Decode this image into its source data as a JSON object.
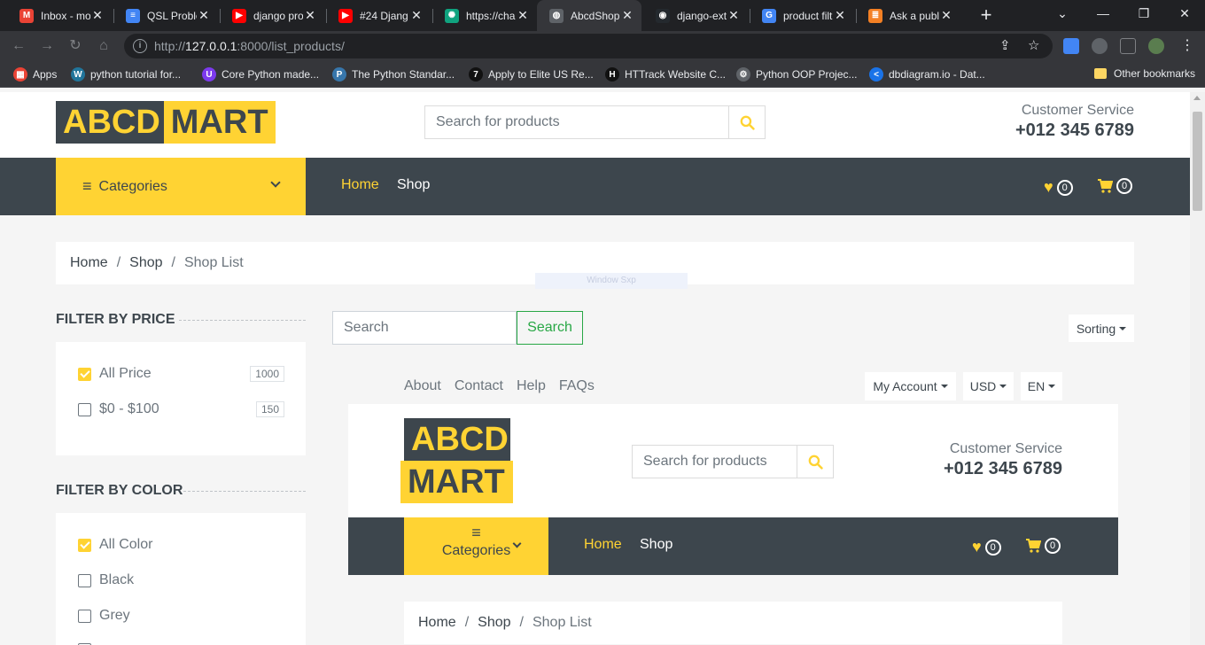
{
  "browser": {
    "tabs": [
      {
        "title": "Inbox - mo",
        "fav_color": "#ea4335",
        "fav_glyph": "M",
        "icon": "gmail-icon"
      },
      {
        "title": "QSL Proble",
        "fav_color": "#4285f4",
        "fav_glyph": "≡",
        "icon": "docs-icon"
      },
      {
        "title": "django pro",
        "fav_color": "#ff0000",
        "fav_glyph": "▶",
        "icon": "youtube-icon"
      },
      {
        "title": "#24 Djang",
        "fav_color": "#ff0000",
        "fav_glyph": "▶",
        "icon": "youtube-icon"
      },
      {
        "title": "https://cha",
        "fav_color": "#10a37f",
        "fav_glyph": "✺",
        "icon": "chatgpt-icon"
      },
      {
        "title": "AbcdShop",
        "fav_color": "#5f6368",
        "fav_glyph": "◍",
        "icon": "globe-icon"
      },
      {
        "title": "django-ext",
        "fav_color": "#24292e",
        "fav_glyph": "◉",
        "icon": "github-icon"
      },
      {
        "title": "product filt",
        "fav_color": "#4285f4",
        "fav_glyph": "G",
        "icon": "google-icon"
      },
      {
        "title": "Ask a publ",
        "fav_color": "#f48024",
        "fav_glyph": "≣",
        "icon": "stackoverflow-icon"
      }
    ],
    "active_tab": 5,
    "url_prefix": "http://",
    "url_host": "127.0.0.1",
    "url_rest": ":8000/list_products/",
    "bookmarks": [
      {
        "label": "Apps",
        "color": "#ea4335",
        "glyph": "▦"
      },
      {
        "label": "python tutorial for...",
        "color": "#21759b",
        "glyph": "W"
      },
      {
        "label": "Core Python made...",
        "color": "#7c3aed",
        "glyph": "U"
      },
      {
        "label": "The Python Standar...",
        "color": "#3776ab",
        "glyph": "P"
      },
      {
        "label": "Apply to Elite US Re...",
        "color": "#111111",
        "glyph": "7"
      },
      {
        "label": "HTTrack Website C...",
        "color": "#111111",
        "glyph": "H"
      },
      {
        "label": "Python OOP Projec...",
        "color": "#5f6368",
        "glyph": "⚙"
      },
      {
        "label": "dbdiagram.io - Dat...",
        "color": "#1a73e8",
        "glyph": "<"
      }
    ],
    "other_bookmarks": "Other bookmarks"
  },
  "site": {
    "logo_part1": "ABCD",
    "logo_part2": "MART",
    "search_placeholder": "Search for products",
    "customer_service_label": "Customer Service",
    "phone": "+012 345 6789",
    "categories_label": "Categories",
    "nav": {
      "home": "Home",
      "shop": "Shop"
    },
    "wishlist_count": "0",
    "cart_count": "0",
    "colors": {
      "primary": "#ffd333",
      "dark": "#3d464d",
      "green": "#28a745"
    }
  },
  "breadcrumb": {
    "home": "Home",
    "shop": "Shop",
    "current": "Shop List"
  },
  "ghost_text": "Window Sxp",
  "filters": {
    "price": {
      "title": "Filter by price",
      "items": [
        {
          "label": "All Price",
          "count": "1000",
          "checked": true
        },
        {
          "label": "$0 - $100",
          "count": "150",
          "checked": false
        }
      ]
    },
    "color": {
      "title": "Filter by color",
      "items": [
        {
          "label": "All Color",
          "checked": true
        },
        {
          "label": "Black",
          "checked": false
        },
        {
          "label": "Grey",
          "checked": false
        }
      ]
    }
  },
  "listing": {
    "search_placeholder": "Search",
    "search_button": "Search",
    "sorting": "Sorting"
  },
  "embedded": {
    "top_links": [
      "About",
      "Contact",
      "Help",
      "FAQs"
    ],
    "my_account": "My Account",
    "currency": "USD",
    "language": "EN"
  }
}
